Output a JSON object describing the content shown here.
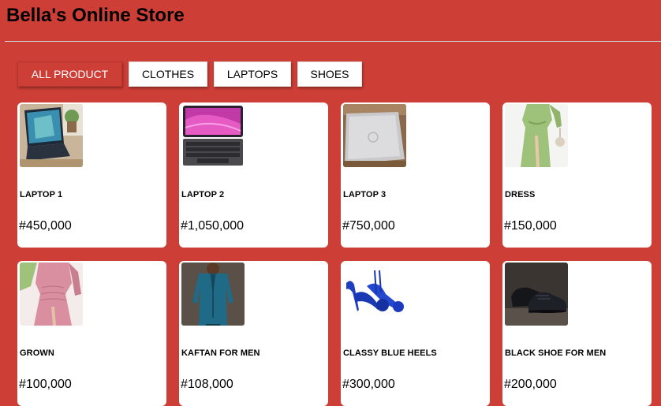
{
  "store": {
    "title": "Bella's Online Store"
  },
  "filters": [
    "ALL PRODUCT",
    "CLOTHES",
    "LAPTOPS",
    "SHOES"
  ],
  "active_filter": "ALL PRODUCT",
  "products": [
    {
      "name": "LAPTOP 1",
      "price": "#450,000",
      "icon": "laptop-photo"
    },
    {
      "name": "LAPTOP 2",
      "price": "#1,050,000",
      "icon": "tablet-laptop-photo"
    },
    {
      "name": "LAPTOP 3",
      "price": "#750,000",
      "icon": "silver-laptop-photo"
    },
    {
      "name": "DRESS",
      "price": "#150,000",
      "icon": "green-dress-photo"
    },
    {
      "name": "GROWN",
      "price": "#100,000",
      "icon": "pink-dress-photo"
    },
    {
      "name": "KAFTAN FOR MEN",
      "price": "#108,000",
      "icon": "kaftan-photo"
    },
    {
      "name": "CLASSY BLUE HEELS",
      "price": "#300,000",
      "icon": "blue-heels-photo"
    },
    {
      "name": "BLACK SHOE FOR MEN",
      "price": "#200,000",
      "icon": "black-shoe-photo"
    }
  ],
  "colors": {
    "background": "#cd3e36",
    "card": "#ffffff",
    "accent": "#cd3e36"
  }
}
